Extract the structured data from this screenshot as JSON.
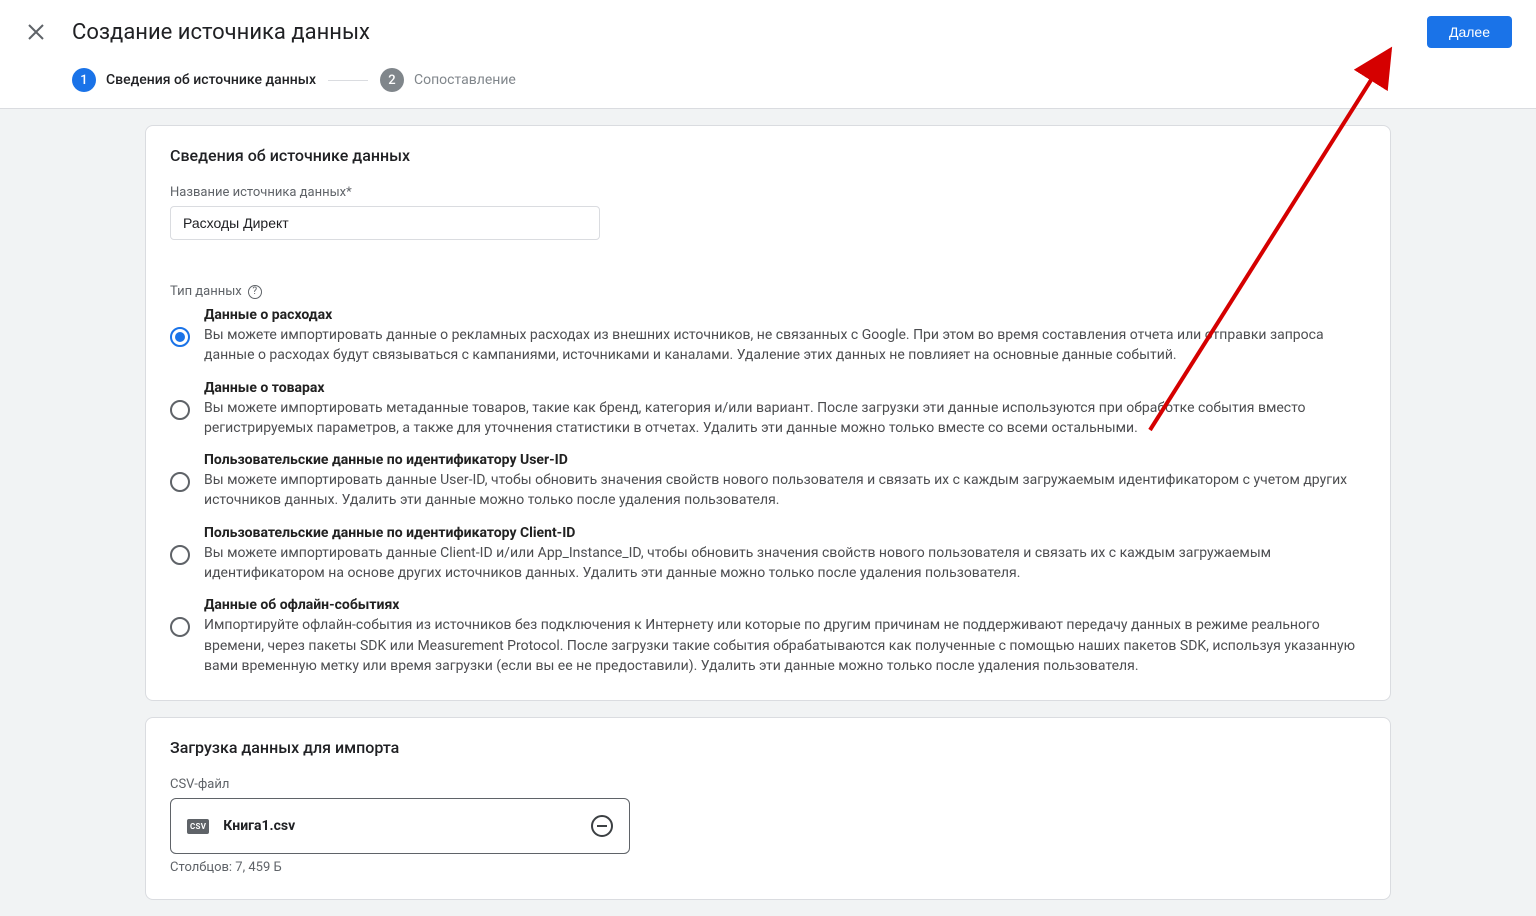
{
  "header": {
    "title": "Создание источника данных",
    "next_button": "Далее"
  },
  "stepper": {
    "step1_num": "1",
    "step1_label": "Сведения об источнике данных",
    "step2_num": "2",
    "step2_label": "Сопоставление"
  },
  "details_card": {
    "title": "Сведения об источнике данных",
    "name_label": "Название источника данных*",
    "name_value": "Расходы Директ",
    "type_label": "Тип данных",
    "help_glyph": "?"
  },
  "radios": [
    {
      "title": "Данные о расходах",
      "desc": "Вы можете импортировать данные о рекламных расходах из внешних источников, не связанных с Google. При этом во время составления отчета или отправки запроса данные о расходах будут связываться с кампаниями, источниками и каналами. Удаление этих данных не повлияет на основные данные событий.",
      "selected": true
    },
    {
      "title": "Данные о товарах",
      "desc": "Вы можете импортировать метаданные товаров, такие как бренд, категория и/или вариант. После загрузки эти данные используются при обработке события вместо регистрируемых параметров, а также для уточнения статистики в отчетах. Удалить эти данные можно только вместе со всеми остальными.",
      "selected": false
    },
    {
      "title": "Пользовательские данные по идентификатору User-ID",
      "desc": "Вы можете импортировать данные User-ID, чтобы обновить значения свойств нового пользователя и связать их с каждым загружаемым идентификатором с учетом других источников данных. Удалить эти данные можно только после удаления пользователя.",
      "selected": false
    },
    {
      "title": "Пользовательские данные по идентификатору Client-ID",
      "desc": "Вы можете импортировать данные Client-ID и/или App_Instance_ID, чтобы обновить значения свойств нового пользователя и связать их с каждым загружаемым идентификатором на основе других источников данных. Удалить эти данные можно только после удаления пользователя.",
      "selected": false
    },
    {
      "title": "Данные об офлайн-событиях",
      "desc": "Импортируйте офлайн-события из источников без подключения к Интернету или которые по другим причинам не поддерживают передачу данных в режиме реального времени, через пакеты SDK или Measurement Protocol. После загрузки такие события обрабатываются как полученные с помощью наших пакетов SDK, используя указанную вами временную метку или время загрузки (если вы ее не предоставили). Удалить эти данные можно только после удаления пользователя.",
      "selected": false
    }
  ],
  "upload_card": {
    "title": "Загрузка данных для импорта",
    "csv_label": "CSV-файл",
    "csv_badge": "CSV",
    "file_name": "Книга1.csv",
    "file_meta": "Столбцов: 7, 459 Б"
  }
}
